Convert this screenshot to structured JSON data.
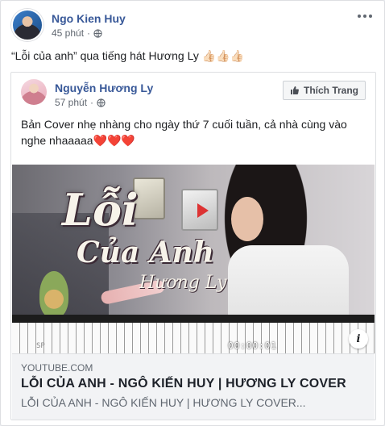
{
  "post": {
    "author": "Ngo Kien Huy",
    "time": "45 phút",
    "text": "“Lỗi của anh” qua tiếng hát Hương Ly 👍🏻👍🏻👍🏻"
  },
  "shared_post": {
    "author": "Nguyễn Hương Ly",
    "time": "57 phút",
    "like_button": "Thích Trang",
    "text": "Bản Cover nhẹ nhàng cho ngày thứ 7 cuối tuần, cả nhà cùng vào nghe nhaaaaa❤️❤️❤️"
  },
  "video": {
    "overlay_title_line1": "Lỗi",
    "overlay_title_line2": "Của Anh",
    "overlay_title_line3": "Hương Ly",
    "corner_text": "SP",
    "timestamp": "00:00:01"
  },
  "link": {
    "domain": "YOUTUBE.COM",
    "title": "LỖI CỦA ANH - NGÔ KIẾN HUY | HƯƠNG LY COVER",
    "description": "LỖI CỦA ANH - NGÔ KIẾN HUY | HƯƠNG LY COVER..."
  },
  "icons": {
    "privacy": "globe-icon",
    "menu": "more-options-icon",
    "like": "thumbs-up-icon",
    "info": "info-icon"
  },
  "colors": {
    "link_blue": "#385898",
    "meta_gray": "#606770",
    "footer_bg": "#f2f3f5"
  }
}
